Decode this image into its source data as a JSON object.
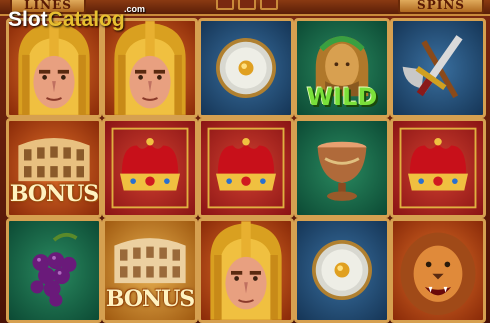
{
  "header": {
    "left_button_label": "LINES",
    "right_button_label": "SPINS"
  },
  "watermark": {
    "brand_part1": "Slot",
    "brand_part2": "Catalog",
    "domain": ".com"
  },
  "reels": {
    "rows": [
      [
        "Roman Soldier",
        "Roman Soldier",
        "Shield",
        "Wild",
        "Axe and Sword"
      ],
      [
        "Bonus",
        "Crown",
        "Crown",
        "Goblet",
        "Crown"
      ],
      [
        "Grapes",
        "Bonus",
        "Roman Soldier",
        "Shield",
        "Lion"
      ]
    ],
    "bonus_label": "BONUS",
    "wild_label": "WILD"
  },
  "colors": {
    "frame_gold": "#d6a050",
    "wild_green": "#7ae03a"
  }
}
